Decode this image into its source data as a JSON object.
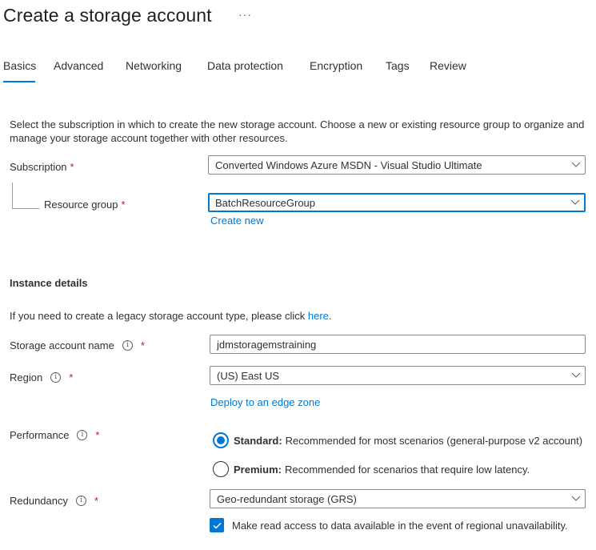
{
  "header": {
    "title": "Create a storage account",
    "more_label": "···"
  },
  "tabs": [
    {
      "label": "Basics",
      "active": true
    },
    {
      "label": "Advanced",
      "active": false
    },
    {
      "label": "Networking",
      "active": false
    },
    {
      "label": "Data protection",
      "active": false
    },
    {
      "label": "Encryption",
      "active": false
    },
    {
      "label": "Tags",
      "active": false
    },
    {
      "label": "Review",
      "active": false
    }
  ],
  "project": {
    "description": "Select the subscription in which to create the new storage account. Choose a new or existing resource group to organize and manage your storage account together with other resources.",
    "subscription": {
      "label": "Subscription",
      "required_mark": "*",
      "value": "Converted Windows Azure MSDN - Visual Studio Ultimate"
    },
    "resource_group": {
      "label": "Resource group",
      "required_mark": "*",
      "value": "BatchResourceGroup",
      "create_new_link": "Create new"
    }
  },
  "instance": {
    "title": "Instance details",
    "legacy_text": "If you need to create a legacy storage account type, please click ",
    "legacy_link": "here",
    "legacy_suffix": ".",
    "storage_name": {
      "label": "Storage account name",
      "info_icon": "i",
      "required_mark": "*",
      "value": "jdmstoragemstraining"
    },
    "region": {
      "label": "Region",
      "info_icon": "i",
      "required_mark": "*",
      "value": "(US) East US",
      "edge_zone_link": "Deploy to an edge zone"
    },
    "performance": {
      "label": "Performance",
      "info_icon": "i",
      "required_mark": "*",
      "options": [
        {
          "name": "Standard:",
          "desc": "Recommended for most scenarios (general-purpose v2 account)",
          "selected": true
        },
        {
          "name": "Premium:",
          "desc": "Recommended for scenarios that require low latency.",
          "selected": false
        }
      ]
    },
    "redundancy": {
      "label": "Redundancy",
      "info_icon": "i",
      "required_mark": "*",
      "value": "Geo-redundant storage (GRS)",
      "read_access_checkbox": {
        "label": "Make read access to data available in the event of regional unavailability.",
        "checked": true
      }
    }
  },
  "colors": {
    "accent": "#0078d4",
    "required": "#a4262c",
    "text": "#323130"
  }
}
